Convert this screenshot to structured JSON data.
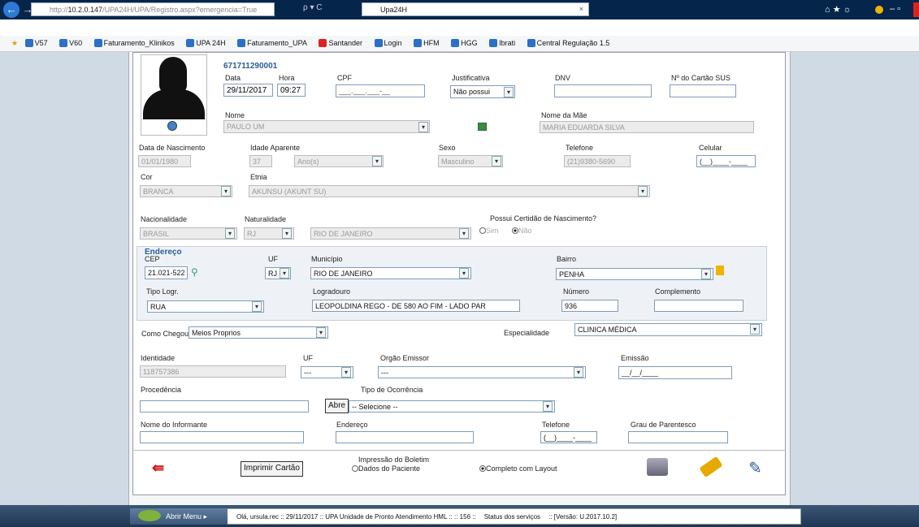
{
  "browser": {
    "url_gray": "http://",
    "url_host": "10.2.0.147",
    "url_path": "/UPA24H/UPA/Registro.aspx?emergencia=True",
    "search_symbol": "ρ ▾ C",
    "tab_title": "Upa24H",
    "tab_close": "×",
    "right_icons": "⌂ ★ ☼",
    "window_controls": "– ▫",
    "favorites": [
      "V57",
      "V60",
      "Faturamento_Klinikos",
      "UPA 24H",
      "Faturamento_UPA",
      "Santander",
      "Login",
      "HFM",
      "HGG",
      "Ibrati",
      "Central Regulação 1.5"
    ]
  },
  "patient": {
    "id_number": "671711290001",
    "data_label": "Data",
    "data_value": "29/11/2017",
    "hora_label": "Hora",
    "hora_value": "09:27",
    "cpf_label": "CPF",
    "cpf_value": "___.___.___-__",
    "justificativa_label": "Justificativa",
    "justificativa_value": "Não possui",
    "dnv_label": "DNV",
    "sus_label": "Nº do Cartão SUS",
    "nome_label": "Nome",
    "nome_value": "PAULO UM",
    "mae_label": "Nome da Mãe",
    "mae_value": "MARIA EDUARDA SILVA",
    "nasc_label": "Data de Nascimento",
    "nasc_value": "01/01/1980",
    "idade_label": "Idade Aparente",
    "idade_value": "37",
    "idade_unit": "Ano(s)",
    "sexo_label": "Sexo",
    "sexo_value": "Masculino",
    "telefone_label": "Telefone",
    "telefone_value": "(21)9380-5690",
    "celular_label": "Celular",
    "celular_value": "(__)____-____",
    "cor_label": "Cor",
    "cor_value": "BRANCA",
    "etnia_label": "Etnia",
    "etnia_value": "AKUNSU (AKUNT SU)",
    "nacionalidade_label": "Nacionalidade",
    "nacionalidade_value": "BRASIL",
    "naturalidade_label": "Naturalidade",
    "naturalidade_uf": "RJ",
    "naturalidade_city": "RIO DE JANEIRO",
    "certidao_label": "Possui Certidão de Nascimento?",
    "certidao_sim": "Sim",
    "certidao_nao": "Não"
  },
  "endereco": {
    "title": "Endereço",
    "cep_label": "CEP",
    "cep_value": "21.021-522",
    "uf_label": "UF",
    "uf_value": "RJ",
    "municipio_label": "Município",
    "municipio_value": "RIO DE JANEIRO",
    "bairro_label": "Bairro",
    "bairro_value": "PENHA",
    "tipo_label": "Tipo Logr.",
    "tipo_value": "RUA",
    "logradouro_label": "Logradouro",
    "logradouro_value": "LEOPOLDINA REGO - DE 580 AO FIM - LADO PAR",
    "numero_label": "Número",
    "numero_value": "936",
    "complemento_label": "Complemento"
  },
  "atendimento": {
    "como_label": "Como Chegou?",
    "como_value": "Meios Proprios",
    "especialidade_label": "Especialidade",
    "especialidade_value": "CLINICA MÉDICA",
    "identidade_label": "Identidade",
    "identidade_value": "118757386",
    "uf_label": "UF",
    "uf_value": "---",
    "orgao_label": "Orgão Emissor",
    "orgao_value": "---",
    "emissao_label": "Emissão",
    "emissao_value": "__/__/____",
    "procedencia_label": "Procedência",
    "abre_label": "Abre",
    "ocorrencia_label": "Tipo de Ocorrência",
    "ocorrencia_value": "-- Selecione --",
    "informante_label": "Nome do Informante",
    "endereco_label": "Endereço",
    "telefone_label": "Telefone",
    "telefone_value": "(__)____-____",
    "grau_label": "Grau de Parentesco"
  },
  "actions": {
    "imprimir_label": "Imprimir Cartão",
    "impressao_title": "Impressão do Boletim",
    "opt_dados": "Dados do Paciente",
    "opt_completo": "Completo com Layout"
  },
  "footer": {
    "menu_label": "Abrir Menu",
    "status_text": "Olá, ursula.rec :: 29/11/2017 :: UPA Unidade de Pronto Atendimento HML :: :: 156 ::",
    "servicos": "Status dos serviços",
    "versao": ":: [Versão: U.2017.10.2]"
  },
  "colors": {
    "titlebar": "#06254a",
    "accent": "#2a5d9a",
    "pagebg": "#d0dae4"
  }
}
